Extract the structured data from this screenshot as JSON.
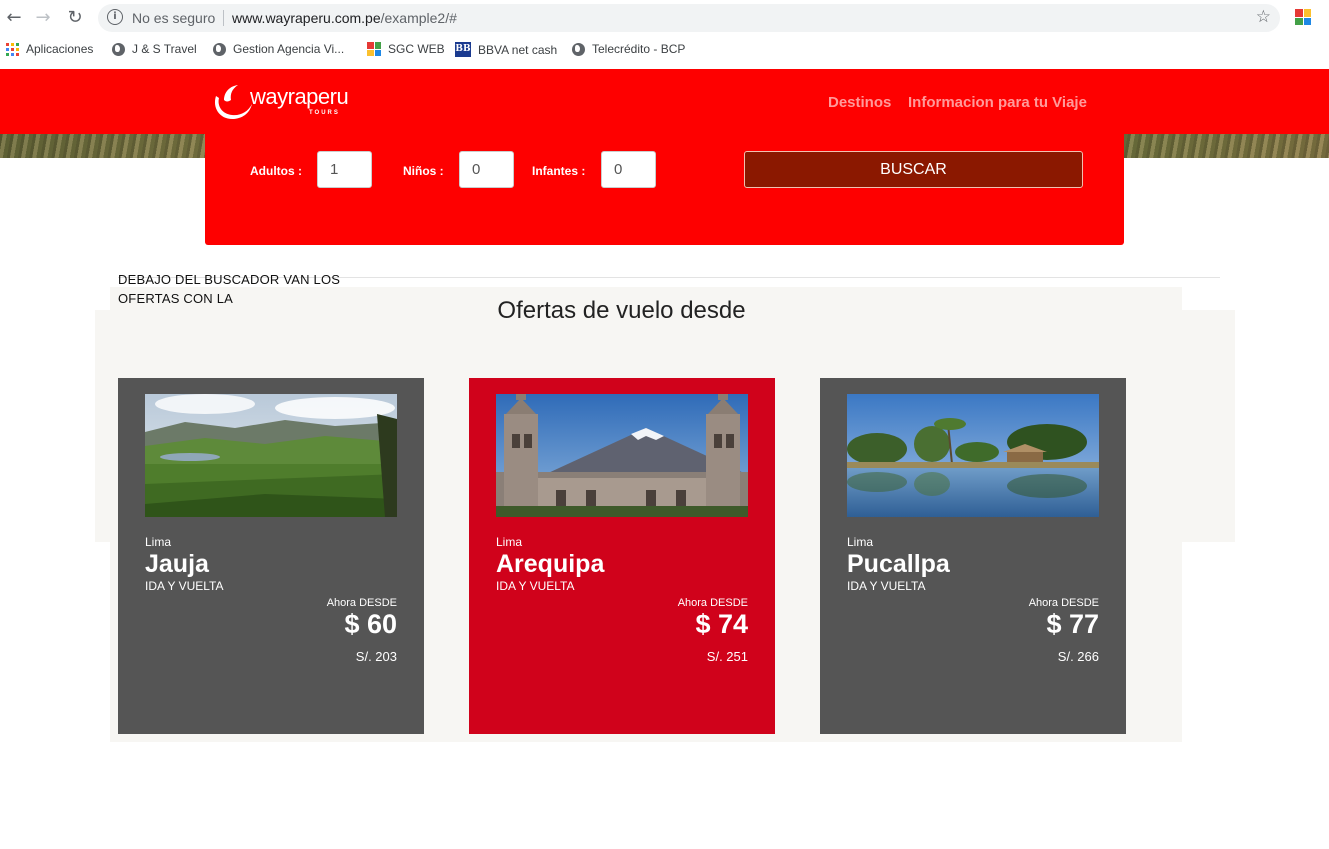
{
  "browser": {
    "insecure_label": "No es seguro",
    "url_host": "www.wayraperu.com.pe",
    "url_path": "/example2/#",
    "bookmarks": [
      {
        "label": "Aplicaciones",
        "icon": "apps-grid-icon"
      },
      {
        "label": "J & S Travel",
        "icon": "globe-icon"
      },
      {
        "label": "Gestion Agencia Vi...",
        "icon": "globe-icon"
      },
      {
        "label": "SGC WEB",
        "icon": "sgc-icon"
      },
      {
        "label": "BBVA net cash",
        "icon": "bbva-icon"
      },
      {
        "label": "Telecrédito - BCP",
        "icon": "globe-icon"
      }
    ]
  },
  "header": {
    "logo_text": "wayraperu",
    "logo_sub": "TOURS",
    "nav": [
      "Destinos",
      "Informacion para tu Viaje"
    ],
    "brand_color": "#fe0000"
  },
  "search": {
    "adults_label": "Adultos :",
    "adults_value": "1",
    "children_label": "Niños :",
    "children_value": "0",
    "infants_label": "Infantes :",
    "infants_value": "0",
    "button_label": "BUSCAR"
  },
  "note": "DEBAJO DEL BUSCADOR VAN LOS OFERTAS CON LA",
  "offers": {
    "title": "Ofertas de vuelo desde",
    "cards": [
      {
        "origin": "Lima",
        "destination": "Jauja",
        "trip": "IDA Y VUELTA",
        "from_label": "Ahora DESDE",
        "price": "$ 60",
        "soles": "S/. 203",
        "color": "#555555",
        "image": "mountain-valley-photo"
      },
      {
        "origin": "Lima",
        "destination": "Arequipa",
        "trip": "IDA Y VUELTA",
        "from_label": "Ahora DESDE",
        "price": "$ 74",
        "soles": "S/. 251",
        "color": "#d0021b",
        "image": "cathedral-volcano-photo"
      },
      {
        "origin": "Lima",
        "destination": "Pucallpa",
        "trip": "IDA Y VUELTA",
        "from_label": "Ahora DESDE",
        "price": "$ 77",
        "soles": "S/. 266",
        "color": "#555555",
        "image": "jungle-lake-photo"
      }
    ]
  }
}
